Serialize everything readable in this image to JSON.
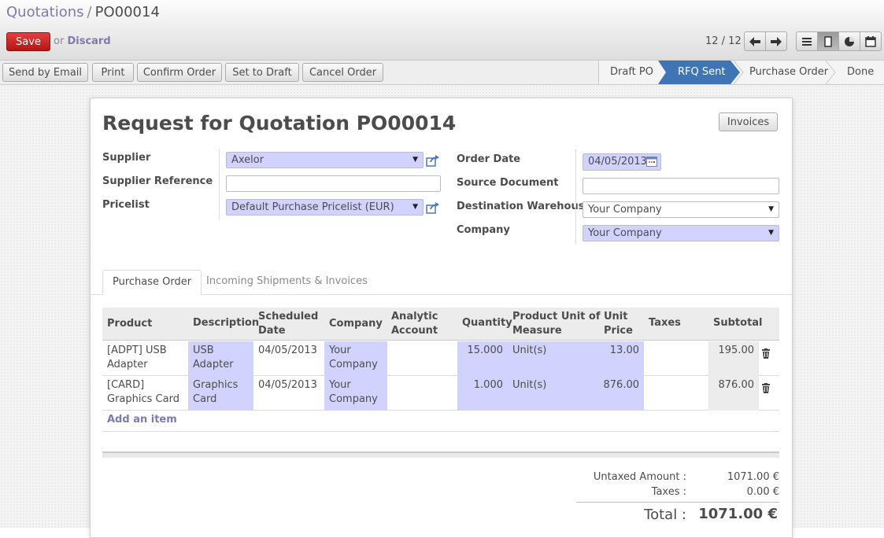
{
  "breadcrumb": {
    "parent": "Quotations",
    "separator": "/",
    "current": "PO00014"
  },
  "toolbar": {
    "save_label": "Save",
    "or_text": "or",
    "discard_label": "Discard"
  },
  "pager": {
    "count": "12 / 12"
  },
  "view_switcher": {
    "icons": [
      "list-view-icon",
      "form-view-icon",
      "graph-view-icon",
      "calendar-view-icon"
    ],
    "active": "form-view-icon"
  },
  "actions": [
    "Send by Email",
    "Print",
    "Confirm Order",
    "Set to Draft",
    "Cancel Order"
  ],
  "stages": {
    "items": [
      "Draft PO",
      "RFQ Sent",
      "Purchase Order",
      "Done"
    ],
    "active": "RFQ Sent",
    "active_color": "#3f75b4"
  },
  "document": {
    "title": "Request for Quotation PO00014",
    "invoices_button": "Invoices"
  },
  "fields": {
    "supplier": {
      "label": "Supplier",
      "value": "Axelor"
    },
    "supplier_reference": {
      "label": "Supplier Reference",
      "value": ""
    },
    "pricelist": {
      "label": "Pricelist",
      "value": "Default Purchase Pricelist (EUR)"
    },
    "order_date": {
      "label": "Order Date",
      "value": "04/05/2013"
    },
    "source_document": {
      "label": "Source Document",
      "value": ""
    },
    "destination_warehouse": {
      "label": "Destination Warehouse",
      "value": "Your Company"
    },
    "company": {
      "label": "Company",
      "value": "Your Company"
    }
  },
  "tabs": [
    "Purchase Order",
    "Incoming Shipments & Invoices"
  ],
  "order_lines": {
    "headers": {
      "product": "Product",
      "description": "Description",
      "scheduled_1": "Scheduled",
      "scheduled_2": "Date",
      "company": "Company",
      "analytic_1": "Analytic",
      "analytic_2": "Account",
      "quantity": "Quantity",
      "uom_1": "Product Unit of",
      "uom_2": "Measure",
      "price_1": "Unit",
      "price_2": "Price",
      "taxes": "Taxes",
      "subtotal": "Subtotal"
    },
    "rows": [
      {
        "product_1": "[ADPT] USB",
        "product_2": "Adapter",
        "desc_1": "USB",
        "desc_2": "Adapter",
        "date": "04/05/2013",
        "company_1": "Your",
        "company_2": "Company",
        "analytic": "",
        "quantity": "15.000",
        "uom": "Unit(s)",
        "price": "13.00",
        "taxes": "",
        "subtotal": "195.00"
      },
      {
        "product_1": "[CARD]",
        "product_2": "Graphics Card",
        "desc_1": "Graphics",
        "desc_2": "Card",
        "date": "04/05/2013",
        "company_1": "Your",
        "company_2": "Company",
        "analytic": "",
        "quantity": "1.000",
        "uom": "Unit(s)",
        "price": "876.00",
        "taxes": "",
        "subtotal": "876.00"
      }
    ],
    "add_item": "Add an item"
  },
  "totals": {
    "untaxed_label": "Untaxed Amount :",
    "untaxed_value": "1071.00 €",
    "taxes_label": "Taxes :",
    "taxes_value": "0.00 €",
    "total_label": "Total :",
    "total_value": "1071.00 €"
  },
  "colors": {
    "required_field": "#d2d2ff",
    "save_button": "#c62828",
    "link": "#7c7bad"
  }
}
